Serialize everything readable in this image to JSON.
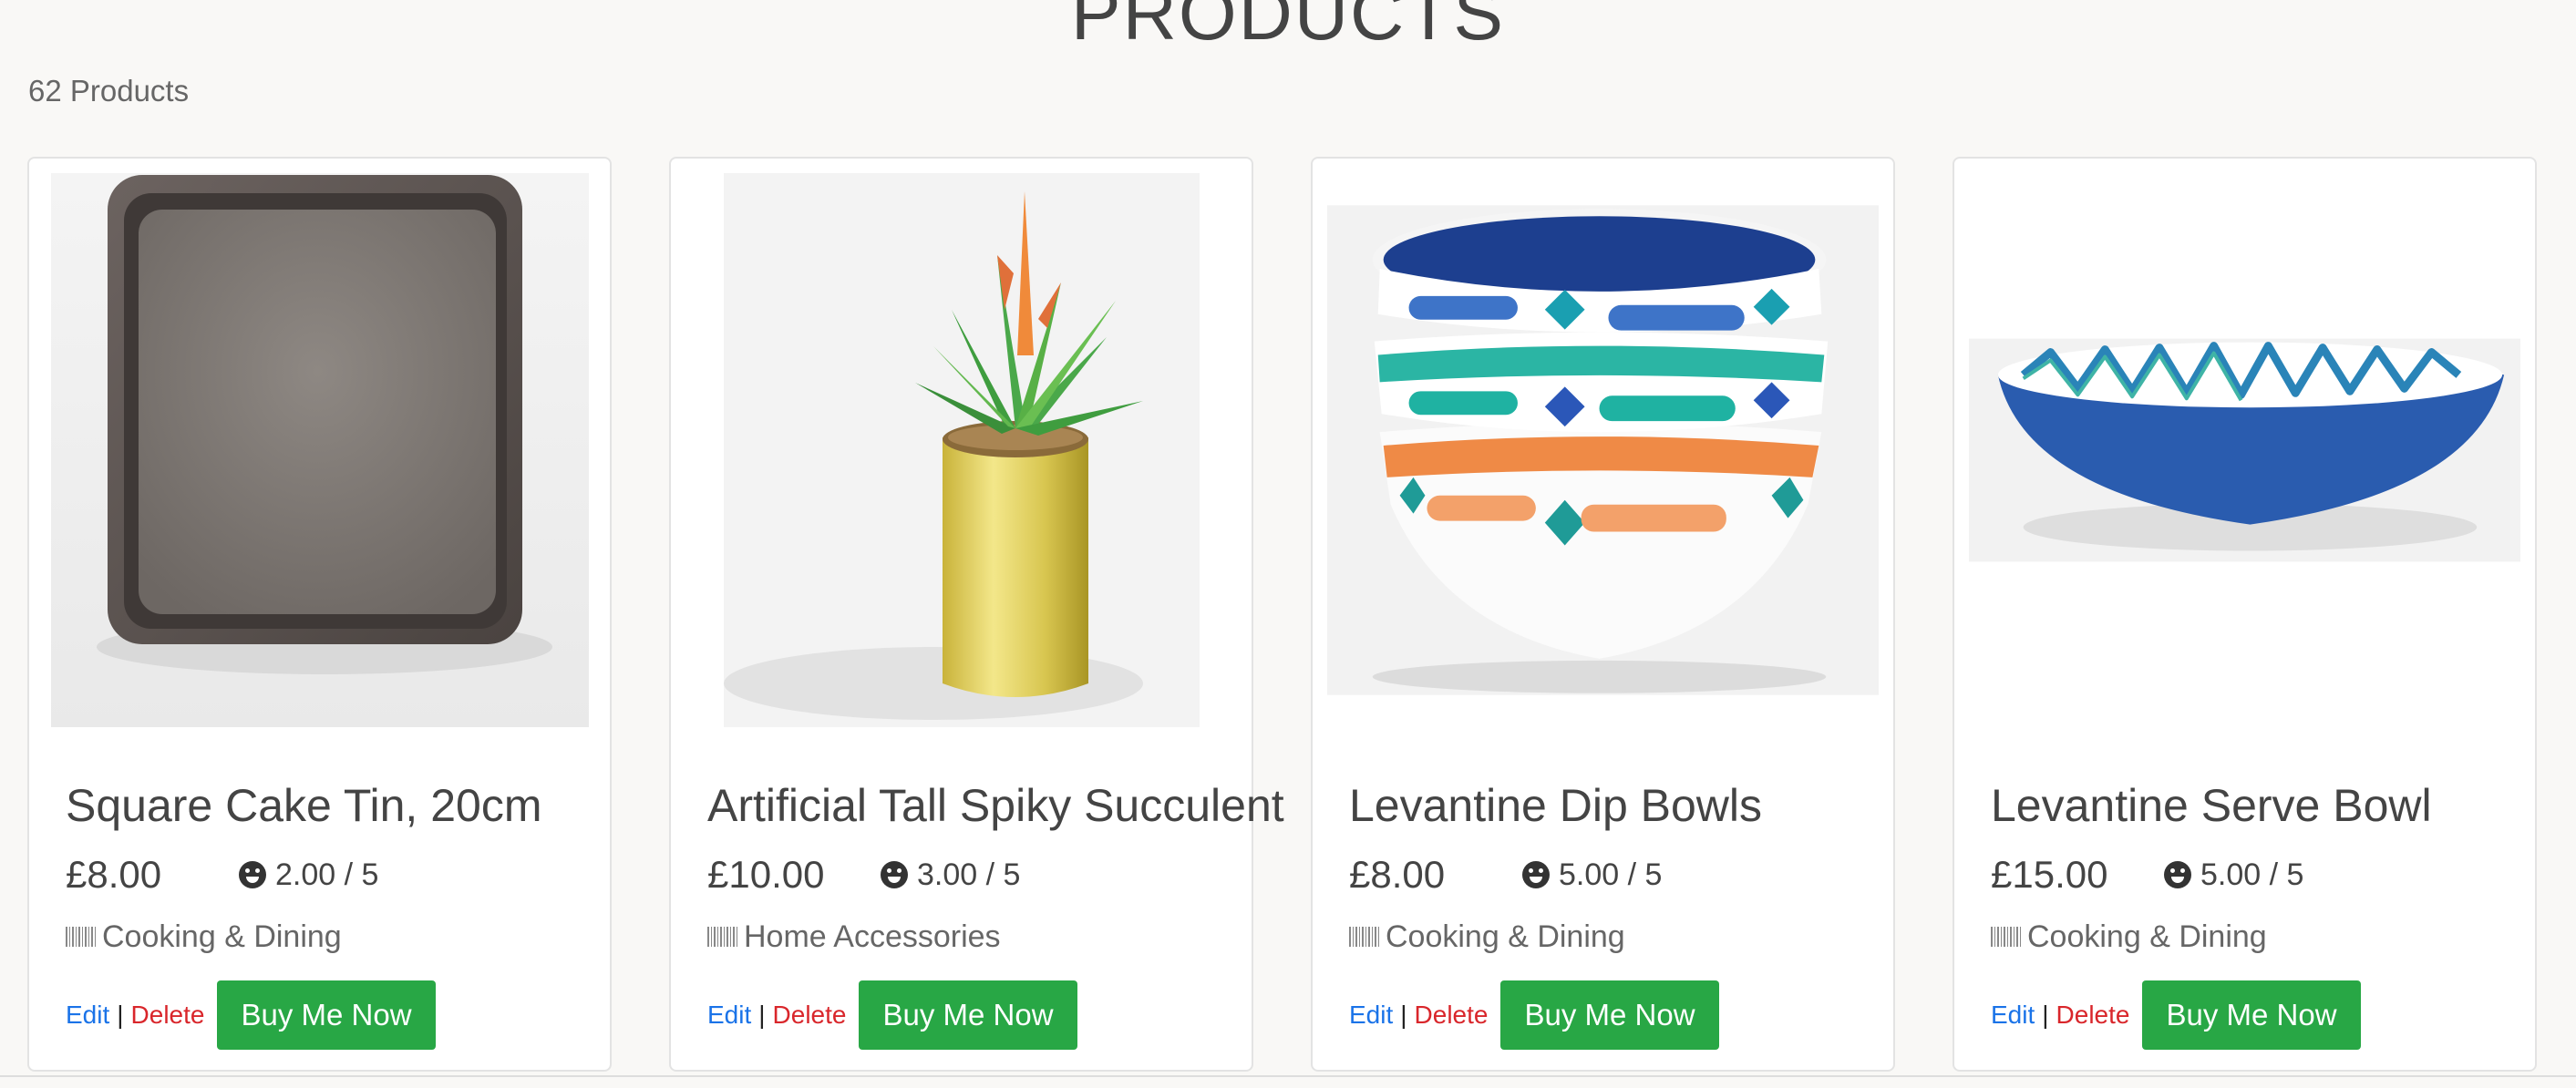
{
  "page": {
    "title": "PRODUCTS",
    "count": "62 Products"
  },
  "colors": {
    "buy_button": "#28a745",
    "edit_link": "#1a73e8",
    "delete_link": "#d9262b"
  },
  "products": [
    {
      "name": "Square Cake Tin, 20cm",
      "price": "£8.00",
      "rating": "2.00 / 5",
      "category": "Cooking & Dining",
      "image": "square-cake-tin-image",
      "edit_label": "Edit",
      "separator": "|",
      "delete_label": "Delete",
      "buy_label": "Buy Me Now"
    },
    {
      "name": "Artificial Tall Spiky Succulent",
      "price": "£10.00",
      "rating": "3.00 / 5",
      "category": "Home Accessories",
      "image": "succulent-plant-image",
      "edit_label": "Edit",
      "separator": "|",
      "delete_label": "Delete",
      "buy_label": "Buy Me Now"
    },
    {
      "name": "Levantine Dip Bowls",
      "price": "£8.00",
      "rating": "5.00 / 5",
      "category": "Cooking & Dining",
      "image": "stacked-dip-bowls-image",
      "edit_label": "Edit",
      "separator": "|",
      "delete_label": "Delete",
      "buy_label": "Buy Me Now"
    },
    {
      "name": "Levantine Serve Bowl",
      "price": "£15.00",
      "rating": "5.00 / 5",
      "category": "Cooking & Dining",
      "image": "serve-bowl-image",
      "edit_label": "Edit",
      "separator": "|",
      "delete_label": "Delete",
      "buy_label": "Buy Me Now"
    }
  ]
}
